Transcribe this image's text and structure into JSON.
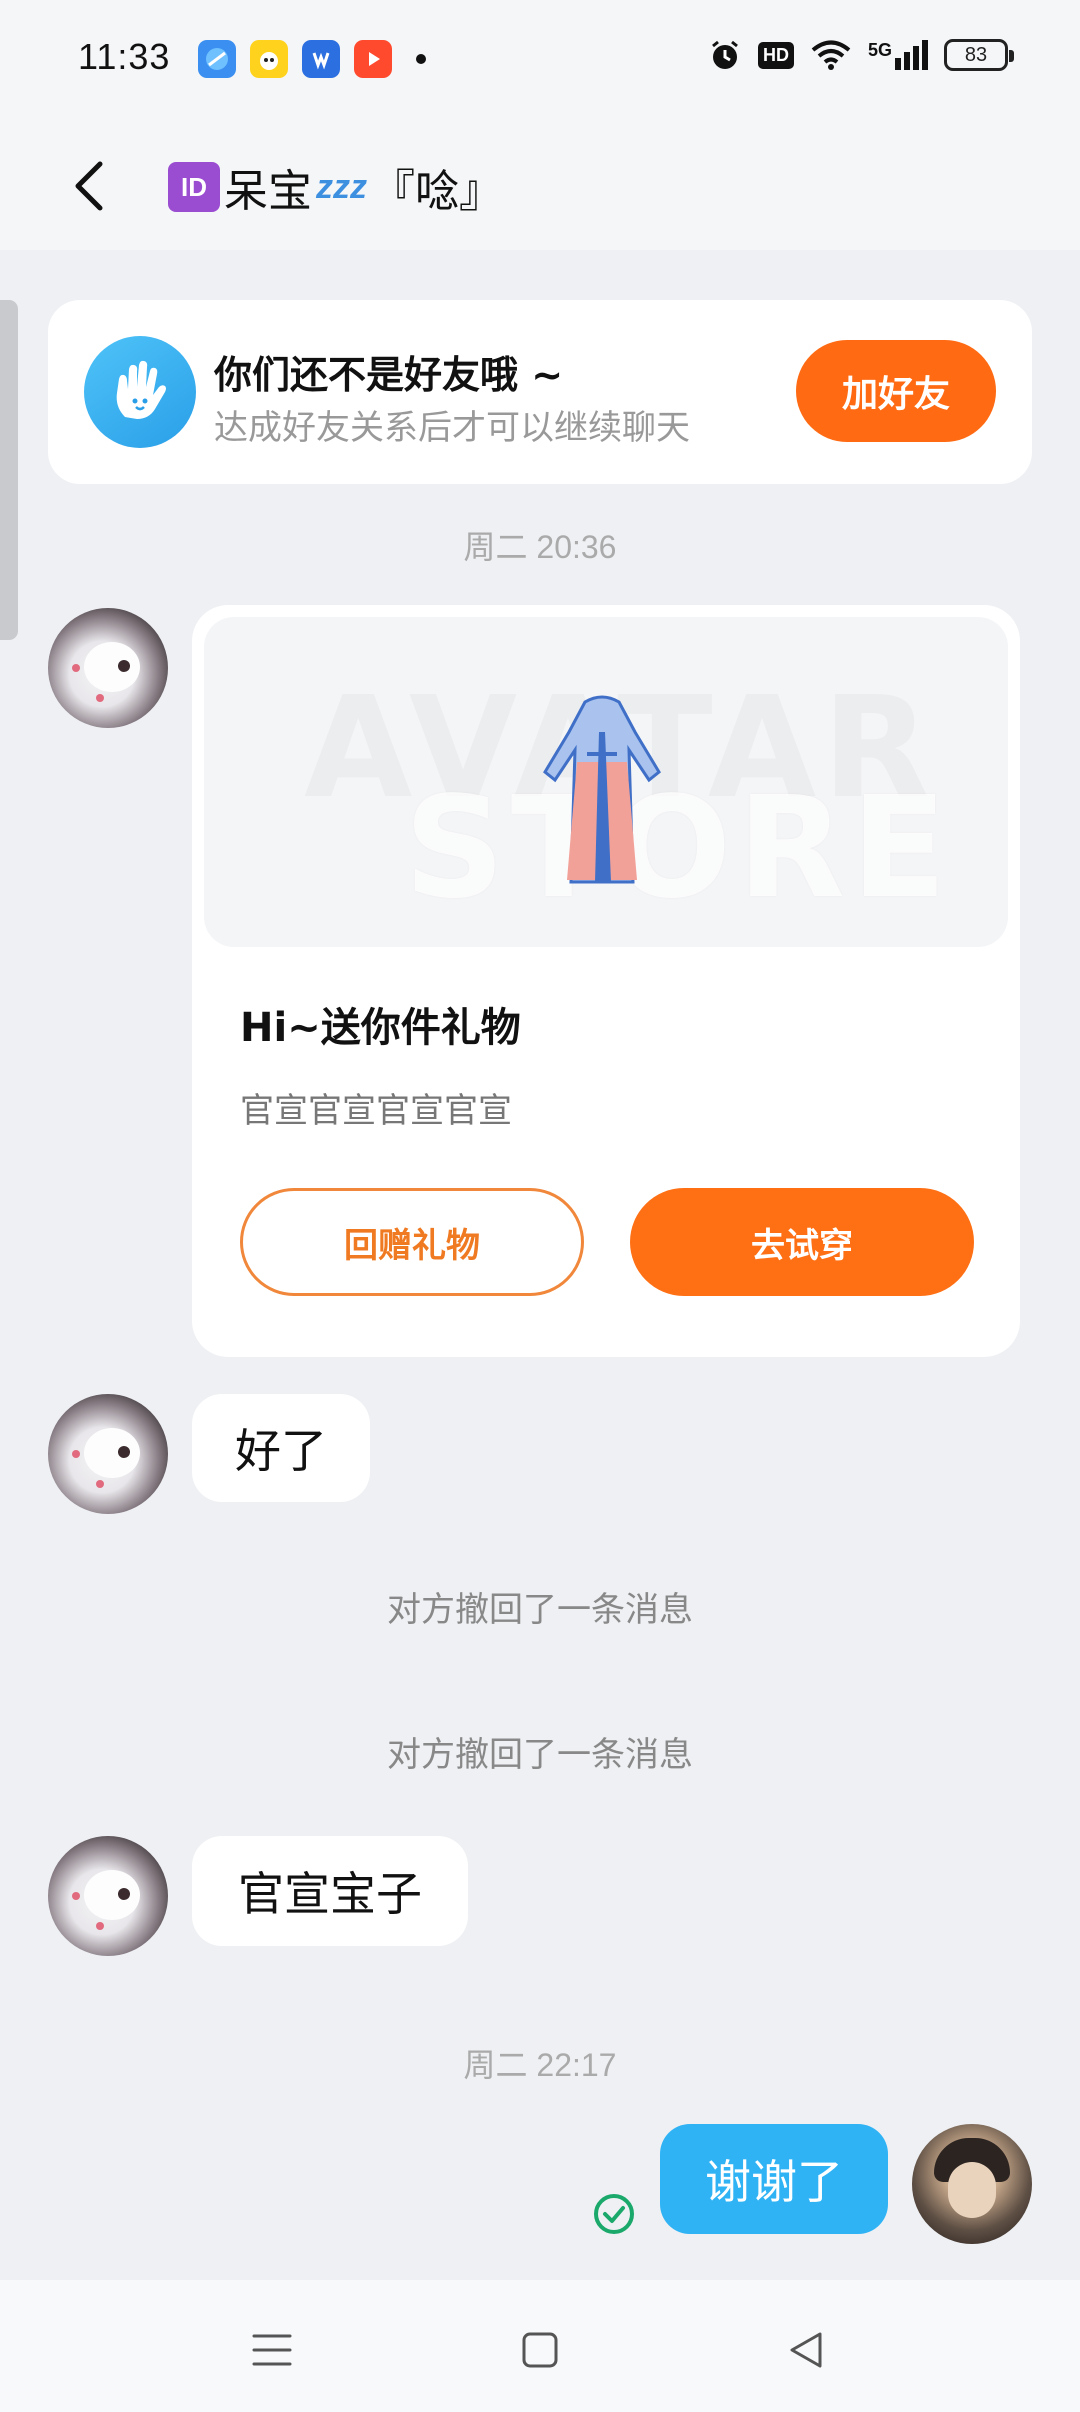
{
  "status_bar": {
    "time": "11:33",
    "app_icons": [
      "browser-icon",
      "game-icon",
      "game-icon-2",
      "video-icon"
    ],
    "network": "5G",
    "hd": "HD",
    "battery": "83"
  },
  "header": {
    "back_icon": "chevron-left-icon",
    "id_badge": "ID",
    "title_name": "呆宝",
    "title_suffix": "『唸』",
    "zzz": "zzz"
  },
  "friend_notice": {
    "title": "你们还不是好友哦 ~",
    "subtitle": "达成好友关系后才可以继续聊天",
    "add_button": "加好友"
  },
  "messages": {
    "time_1": "周二 20:36",
    "gift": {
      "watermark_1": "AVATAR",
      "watermark_2": "STORE",
      "title": "Hi~送你件礼物",
      "description": "官宣官宣官宣官宣",
      "return_button": "回赠礼物",
      "try_button": "去试穿"
    },
    "msg_1": "好了",
    "recall_1": "对方撤回了一条消息",
    "recall_2": "对方撤回了一条消息",
    "msg_2": "官宣宝子",
    "time_2": "周二 22:17",
    "my_msg": "谢谢了"
  },
  "colors": {
    "accent_orange": "#ff6a12",
    "bubble_blue": "#2fb3f5",
    "read_green": "#1aa86b"
  }
}
